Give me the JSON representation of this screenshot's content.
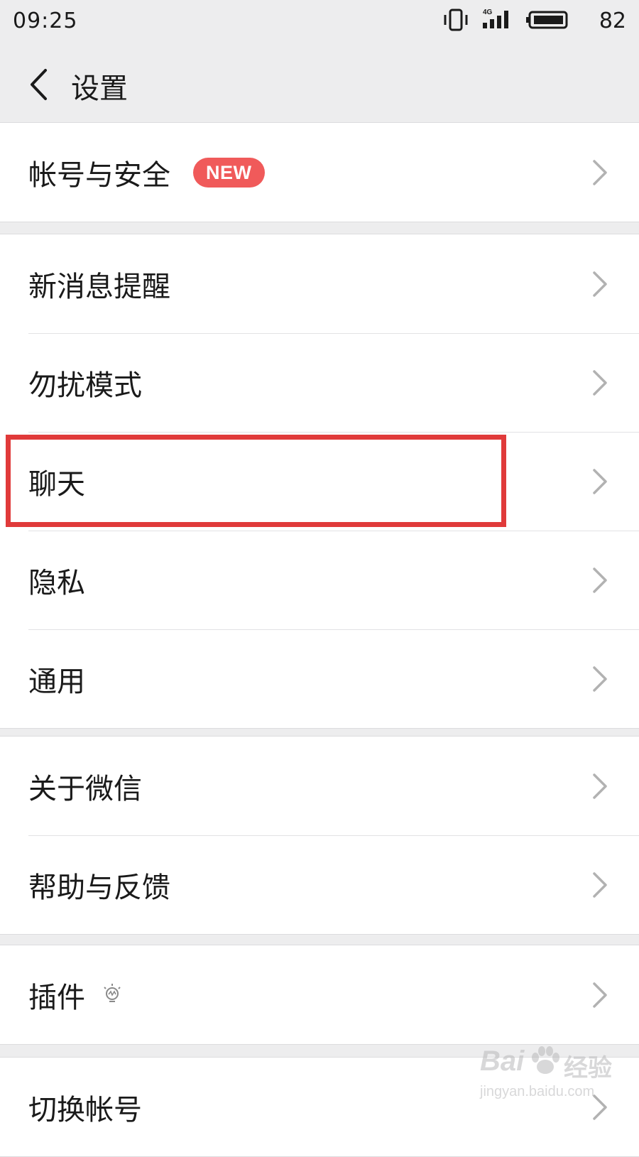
{
  "status_bar": {
    "time": "09:25",
    "network": "4G",
    "battery_percent": "82",
    "icons": [
      "vibrate-icon",
      "signal-icon",
      "battery-icon"
    ]
  },
  "nav": {
    "title": "设置",
    "back_icon": "chevron-left-icon"
  },
  "groups": [
    {
      "items": [
        {
          "label": "帐号与安全",
          "badge": "NEW"
        }
      ]
    },
    {
      "items": [
        {
          "label": "新消息提醒"
        },
        {
          "label": "勿扰模式"
        },
        {
          "label": "聊天",
          "highlighted": true
        },
        {
          "label": "隐私"
        },
        {
          "label": "通用"
        }
      ]
    },
    {
      "items": [
        {
          "label": "关于微信"
        },
        {
          "label": "帮助与反馈"
        }
      ]
    },
    {
      "items": [
        {
          "label": "插件",
          "icon": "lightbulb-icon"
        }
      ]
    },
    {
      "items": [
        {
          "label": "切换帐号"
        }
      ]
    }
  ],
  "watermark": {
    "brand": "Bai",
    "brand_cn": "经验",
    "url": "jingyan.baidu.com"
  },
  "colors": {
    "background": "#ededee",
    "badge": "#f05a5a",
    "highlight": "#e03a3a",
    "chevron": "#b2b2b2"
  }
}
